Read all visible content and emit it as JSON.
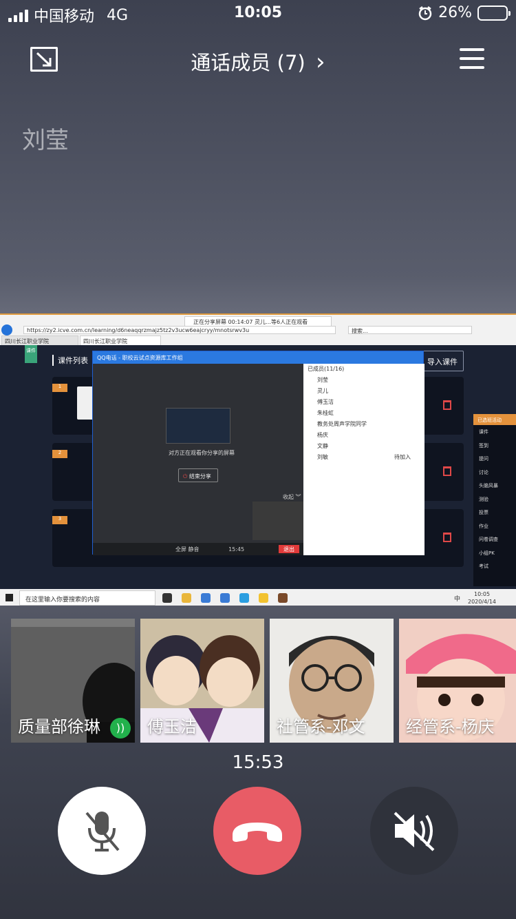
{
  "status_bar": {
    "carrier": "中国移动",
    "network": "4G",
    "time": "10:05",
    "battery_percent": "26%",
    "battery_level": 0.26
  },
  "header": {
    "title": "通话成员 (7)",
    "chevron": "›",
    "minimize_icon": "minimize-window-icon",
    "menu_icon": "hamburger-menu-icon"
  },
  "speaker": {
    "name": "刘莹"
  },
  "shared_screen": {
    "share_banner": "正在分享屏幕     00:14:07          灵儿…等6人正在观看",
    "url": "https://zy2.icve.com.cn/learning/d6neaqqrzmajz5tz2v3ucw6eajcryy/mnotsrwv3u",
    "browser_search": "搜索...",
    "tabs": [
      "四川长江职业学院",
      "四川长江职业学院"
    ],
    "bookmark_label": "课件",
    "list_title": "课件列表",
    "import_button": "导入课件",
    "card_numbers": [
      "1",
      "2",
      "3"
    ],
    "qq_window": {
      "title": "QQ电话 - 职校云试点资源库工作组",
      "sharing_note": "对方正在观看你分享的屏幕",
      "end_share": "结束分享",
      "collapse": "收起 ︾",
      "toolbar": "全屏     静音",
      "call_time": "15:45",
      "end_button": "退出",
      "members_header": "已成员(11/16)",
      "members": [
        {
          "name": "刘莹",
          "status": ""
        },
        {
          "name": "灵儿",
          "status": ""
        },
        {
          "name": "傅玉洁",
          "status": ""
        },
        {
          "name": "朱桂虹",
          "status": ""
        },
        {
          "name": "教务处周声学院同学",
          "status": ""
        },
        {
          "name": "杨庆",
          "status": ""
        },
        {
          "name": "文静",
          "status": ""
        },
        {
          "name": "刘敏",
          "status": "待加入"
        }
      ]
    },
    "right_toolbar": {
      "header": "已选班活动",
      "items": [
        "课件",
        "签到",
        "提问",
        "讨论",
        "头脑风暴",
        "测验",
        "投票",
        "作业",
        "问卷调查",
        "小组PK",
        "考试"
      ]
    },
    "taskbar": {
      "search": "在这里输入你要搜索的内容",
      "time": "10:05",
      "date": "2020/4/14",
      "ime": "中"
    }
  },
  "participants": [
    {
      "name": "质量部徐琳",
      "speaking": true,
      "speaking_icon": "voice-activity-icon",
      "bg": "#6a6a6a"
    },
    {
      "name": "傅玉洁",
      "speaking": false,
      "bg": "#c9b79a"
    },
    {
      "name": "社管系-邓文",
      "speaking": false,
      "bg": "#e8e6e2"
    },
    {
      "name": "经管系-杨庆",
      "speaking": false,
      "bg": "#f3c7bf"
    }
  ],
  "call": {
    "duration": "15:53",
    "mute_icon": "microphone-muted-icon",
    "hangup_icon": "phone-hangup-icon",
    "speaker_icon": "speaker-muted-icon"
  },
  "colors": {
    "hangup": "#e85c66",
    "mute_bg": "#ffffff",
    "speaker_bg": "#2f323b",
    "accent_orange": "#e4923c",
    "speaking_green": "#22b14c"
  }
}
